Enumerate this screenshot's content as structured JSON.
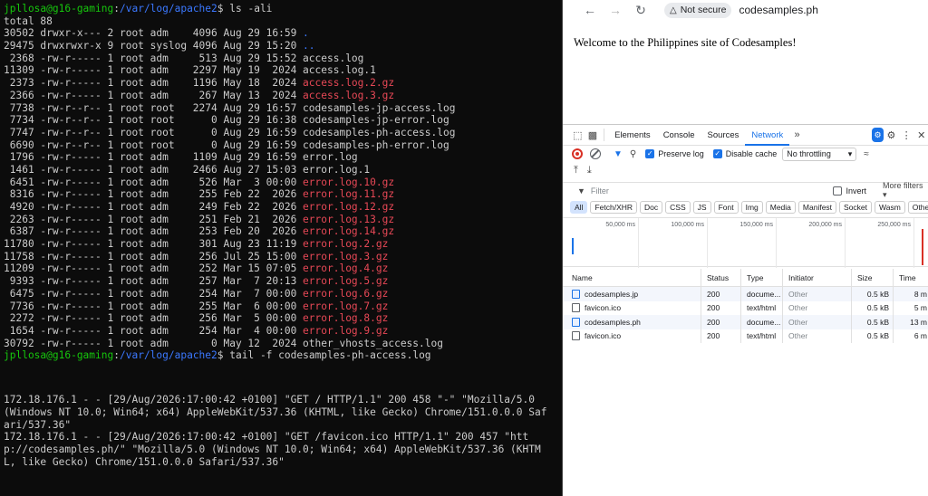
{
  "terminal": {
    "prompt1": {
      "user": "jpllosa@g16-gaming",
      "path": "/var/log/apache2",
      "cmd": " ls -ali"
    },
    "total": "total 88",
    "listing": [
      {
        "meta": "30502 drwxr-x--- 2 root adm    4096 Aug 29 16:59 ",
        "name": ".",
        "color": "blue"
      },
      {
        "meta": "29475 drwxrwxr-x 9 root syslog 4096 Aug 29 15:20 ",
        "name": "..",
        "color": "blue"
      },
      {
        "meta": " 2368 -rw-r----- 1 root adm     513 Aug 29 15:52 ",
        "name": "access.log",
        "color": "plain"
      },
      {
        "meta": "11309 -rw-r----- 1 root adm    2297 May 19  2024 ",
        "name": "access.log.1",
        "color": "plain"
      },
      {
        "meta": " 2373 -rw-r----- 1 root adm    1196 May 18  2024 ",
        "name": "access.log.2.gz",
        "color": "red"
      },
      {
        "meta": " 2366 -rw-r----- 1 root adm     267 May 13  2024 ",
        "name": "access.log.3.gz",
        "color": "red"
      },
      {
        "meta": " 7738 -rw-r--r-- 1 root root   2274 Aug 29 16:57 ",
        "name": "codesamples-jp-access.log",
        "color": "plain"
      },
      {
        "meta": " 7734 -rw-r--r-- 1 root root      0 Aug 29 16:38 ",
        "name": "codesamples-jp-error.log",
        "color": "plain"
      },
      {
        "meta": " 7747 -rw-r--r-- 1 root root      0 Aug 29 16:59 ",
        "name": "codesamples-ph-access.log",
        "color": "plain"
      },
      {
        "meta": " 6690 -rw-r--r-- 1 root root      0 Aug 29 16:59 ",
        "name": "codesamples-ph-error.log",
        "color": "plain"
      },
      {
        "meta": " 1796 -rw-r----- 1 root adm    1109 Aug 29 16:59 ",
        "name": "error.log",
        "color": "plain"
      },
      {
        "meta": " 1461 -rw-r----- 1 root adm    2466 Aug 27 15:03 ",
        "name": "error.log.1",
        "color": "plain"
      },
      {
        "meta": " 6451 -rw-r----- 1 root adm     526 Mar  3 00:00 ",
        "name": "error.log.10.gz",
        "color": "red"
      },
      {
        "meta": " 8316 -rw-r----- 1 root adm     255 Feb 22  2026 ",
        "name": "error.log.11.gz",
        "color": "red"
      },
      {
        "meta": " 4920 -rw-r----- 1 root adm     249 Feb 22  2026 ",
        "name": "error.log.12.gz",
        "color": "red"
      },
      {
        "meta": " 2263 -rw-r----- 1 root adm     251 Feb 21  2026 ",
        "name": "error.log.13.gz",
        "color": "red"
      },
      {
        "meta": " 6387 -rw-r----- 1 root adm     253 Feb 20  2026 ",
        "name": "error.log.14.gz",
        "color": "red"
      },
      {
        "meta": "11780 -rw-r----- 1 root adm     301 Aug 23 11:19 ",
        "name": "error.log.2.gz",
        "color": "red"
      },
      {
        "meta": "11758 -rw-r----- 1 root adm     256 Jul 25 15:00 ",
        "name": "error.log.3.gz",
        "color": "red"
      },
      {
        "meta": "11209 -rw-r----- 1 root adm     252 Mar 15 07:05 ",
        "name": "error.log.4.gz",
        "color": "red"
      },
      {
        "meta": " 9393 -rw-r----- 1 root adm     257 Mar  7 20:13 ",
        "name": "error.log.5.gz",
        "color": "red"
      },
      {
        "meta": " 6475 -rw-r----- 1 root adm     254 Mar  7 00:00 ",
        "name": "error.log.6.gz",
        "color": "red"
      },
      {
        "meta": " 7736 -rw-r----- 1 root adm     255 Mar  6 00:00 ",
        "name": "error.log.7.gz",
        "color": "red"
      },
      {
        "meta": " 2272 -rw-r----- 1 root adm     256 Mar  5 00:00 ",
        "name": "error.log.8.gz",
        "color": "red"
      },
      {
        "meta": " 1654 -rw-r----- 1 root adm     254 Mar  4 00:00 ",
        "name": "error.log.9.gz",
        "color": "red"
      },
      {
        "meta": "30792 -rw-r----- 1 root adm       0 May 12  2024 ",
        "name": "other_vhosts_access.log",
        "color": "plain"
      }
    ],
    "prompt2": {
      "user": "jpllosa@g16-gaming",
      "path": "/var/log/apache2",
      "cmd": " tail -f codesamples-ph-access.log"
    },
    "log_lines": [
      "172.18.176.1 - - [29/Aug/2026:17:00:42 +0100] \"GET / HTTP/1.1\" 200 458 \"-\" \"Mozilla/5.0 (Windows NT 10.0; Win64; x64) AppleWebKit/537.36 (KHTML, like Gecko) Chrome/151.0.0.0 Safari/537.36\"",
      "172.18.176.1 - - [29/Aug/2026:17:00:42 +0100] \"GET /favicon.ico HTTP/1.1\" 200 457 \"http://codesamples.ph/\" \"Mozilla/5.0 (Windows NT 10.0; Win64; x64) AppleWebKit/537.36 (KHTML, like Gecko) Chrome/151.0.0.0 Safari/537.36\""
    ],
    "colors": {
      "user": "#16c60c",
      "path": "#3b78ff",
      "red": "#e74856",
      "blue": "#3b78ff",
      "bg": "#0c0c0c"
    }
  },
  "browser": {
    "security": "Not secure",
    "url": "codesamples.ph",
    "page_text": "Welcome to the Philippines site of Codesamples!",
    "icons": {
      "back": "arrow-left-icon",
      "forward": "arrow-right-icon",
      "reload": "reload-icon",
      "warning": "warning-icon"
    }
  },
  "devtools": {
    "tabs": [
      "Elements",
      "Console",
      "Sources",
      "Network"
    ],
    "active_tab": "Network",
    "preserve_log": "Preserve log",
    "disable_cache": "Disable cache",
    "throttling": "No throttling",
    "filter_placeholder": "Filter",
    "invert": "Invert",
    "more_filters": "More filters",
    "type_filters": [
      "All",
      "Fetch/XHR",
      "Doc",
      "CSS",
      "JS",
      "Font",
      "Img",
      "Media",
      "Manifest",
      "Socket",
      "Wasm",
      "Other"
    ],
    "timeline_ticks": [
      "50,000 ms",
      "100,000 ms",
      "150,000 ms",
      "200,000 ms",
      "250,000 ms"
    ],
    "columns": {
      "name": "Name",
      "status": "Status",
      "type": "Type",
      "initiator": "Initiator",
      "size": "Size",
      "time": "Time"
    },
    "requests": [
      {
        "name": "codesamples.jp",
        "status": "200",
        "type": "docume...",
        "initiator": "Other",
        "size": "0.5 kB",
        "time": "8 m",
        "kind": "doc"
      },
      {
        "name": "favicon.ico",
        "status": "200",
        "type": "text/html",
        "initiator": "Other",
        "size": "0.5 kB",
        "time": "5 m",
        "kind": "file"
      },
      {
        "name": "codesamples.ph",
        "status": "200",
        "type": "docume...",
        "initiator": "Other",
        "size": "0.5 kB",
        "time": "13 m",
        "kind": "doc"
      },
      {
        "name": "favicon.ico",
        "status": "200",
        "type": "text/html",
        "initiator": "Other",
        "size": "0.5 kB",
        "time": "6 m",
        "kind": "file"
      }
    ]
  }
}
